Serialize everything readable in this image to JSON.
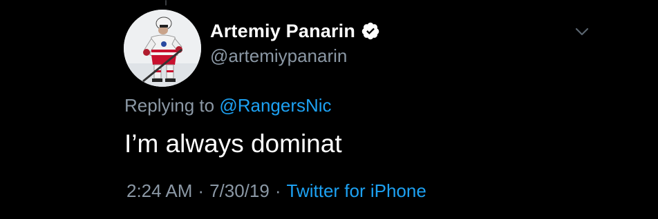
{
  "tweet": {
    "display_name": "Artemiy Panarin",
    "handle": "@artemiypanarin",
    "verified": true,
    "verified_icon": "verified-badge-icon",
    "replying_prefix": "Replying to",
    "replying_to": "@RangersNic",
    "text": "I’m always dominat",
    "time": "2:24 AM",
    "separator": "·",
    "date": "7/30/19",
    "source": "Twitter for iPhone",
    "menu_icon": "chevron-down-icon",
    "avatar_icon": "profile-photo-hockey-player"
  },
  "colors": {
    "background": "#000000",
    "primary_text": "#ffffff",
    "secondary_text": "#8b98a5",
    "accent": "#1da1f2"
  }
}
